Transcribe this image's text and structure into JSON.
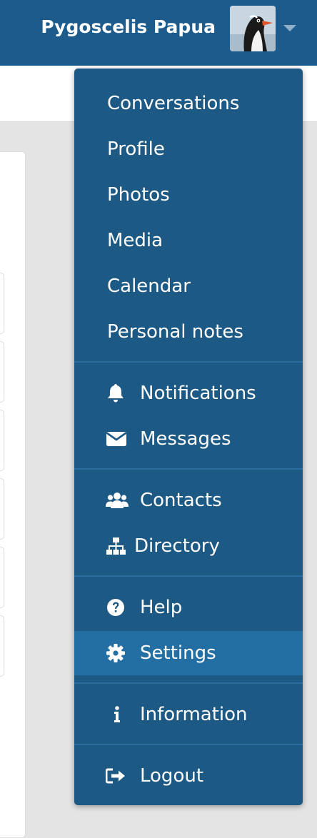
{
  "header": {
    "username": "Pygoscelis Papua",
    "avatar_alt": "penguin avatar",
    "caret_icon": "caret-down-icon"
  },
  "menu": {
    "items": [
      {
        "id": "conversations",
        "label": "Conversations",
        "icon": null
      },
      {
        "id": "profile",
        "label": "Profile",
        "icon": null
      },
      {
        "id": "photos",
        "label": "Photos",
        "icon": null
      },
      {
        "id": "media",
        "label": "Media",
        "icon": null
      },
      {
        "id": "calendar",
        "label": "Calendar",
        "icon": null
      },
      {
        "id": "personal-notes",
        "label": "Personal notes",
        "icon": null
      },
      {
        "id": "notifications",
        "label": "Notifications",
        "icon": "bell-icon"
      },
      {
        "id": "messages",
        "label": "Messages",
        "icon": "envelope-icon"
      },
      {
        "id": "contacts",
        "label": "Contacts",
        "icon": "users-icon"
      },
      {
        "id": "directory",
        "label": "Directory",
        "icon": "sitemap-icon"
      },
      {
        "id": "help",
        "label": "Help",
        "icon": "question-circle-icon"
      },
      {
        "id": "settings",
        "label": "Settings",
        "icon": "cog-icon",
        "active": true
      },
      {
        "id": "information",
        "label": "Information",
        "icon": "info-icon"
      },
      {
        "id": "logout",
        "label": "Logout",
        "icon": "sign-out-icon"
      }
    ]
  },
  "colors": {
    "topbar": "#1d5b8c",
    "menu_bg": "#1c5985",
    "menu_active": "#236ea3",
    "divider": "#2a6c9e",
    "text": "#ffffff"
  }
}
